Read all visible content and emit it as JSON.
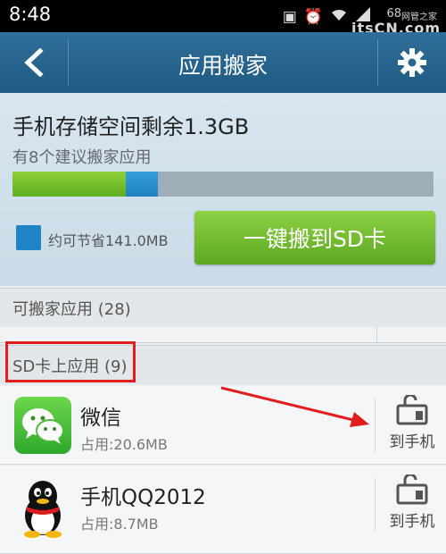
{
  "status_bar": {
    "time": "8:48",
    "icons": [
      "image-icon",
      "alarm-icon",
      "wifi-icon",
      "signal-icon"
    ],
    "battery_text": "68"
  },
  "watermark": {
    "brand": "itsCN.com",
    "sub": "网管之家"
  },
  "title_bar": {
    "title": "应用搬家"
  },
  "storage": {
    "title": "手机存储空间剩余1.3GB",
    "subtitle": "有8个建议搬家应用",
    "used_fraction": 0.27,
    "saveable_fraction": 0.075,
    "legend": "约可节省141.0MB",
    "move_button_label": "一键搬到SD卡",
    "colors": {
      "used": "#6cbb2b",
      "saveable": "#1f84c3",
      "track": "#9eaeb8"
    }
  },
  "sections": [
    {
      "label": "可搬家应用 (28)"
    },
    {
      "label": "SD卡上应用 (9)"
    }
  ],
  "apps": [
    {
      "name": "微信",
      "size": "占用:20.6MB",
      "icon": "wechat-icon",
      "action": "到手机"
    },
    {
      "name": "手机QQ2012",
      "size": "占用:8.7MB",
      "icon": "qq-icon",
      "action": "到手机"
    }
  ],
  "annotation": {
    "highlight_color": "#e01e1e"
  }
}
